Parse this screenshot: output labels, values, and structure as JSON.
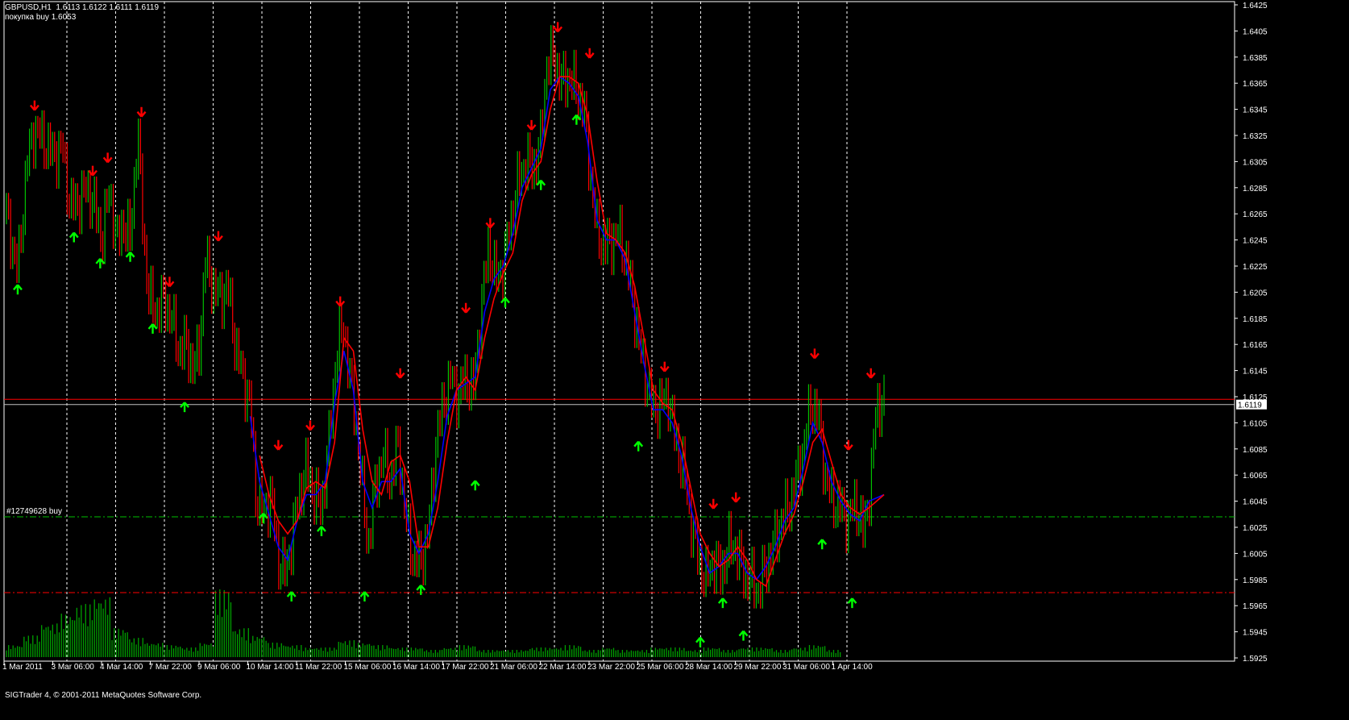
{
  "header": {
    "symbol_line": "GBPUSD,H1  1.6113 1.6122 1.6111 1.6119",
    "order_line": "покупка buy 1.6053"
  },
  "order_label": "#12749628 buy",
  "copyright": "SIGTrader 4, © 2001-2011 MetaQuotes Software Corp.",
  "colors": {
    "background": "#000000",
    "up_bar": "#00c000",
    "down_bar": "#ff0000",
    "ma_fast": "#0000ff",
    "ma_slow": "#ff0000",
    "buy_arrow": "#00ff00",
    "sell_arrow": "#ff0000",
    "volume": "#00a000",
    "grid": "#ffffff",
    "order_line": "#00c000",
    "stop_line": "#ff0000"
  },
  "chart_data": {
    "type": "candlestick",
    "symbol": "GBPUSD",
    "timeframe": "H1",
    "last": {
      "open": 1.6113,
      "high": 1.6122,
      "low": 1.6111,
      "close": 1.6119
    },
    "ylim": [
      1.5925,
      1.6425
    ],
    "yticks": [
      "1.6425",
      "1.6405",
      "1.6385",
      "1.6365",
      "1.6345",
      "1.6325",
      "1.6305",
      "1.6285",
      "1.6265",
      "1.6245",
      "1.6225",
      "1.6205",
      "1.6185",
      "1.6165",
      "1.6145",
      "1.6125",
      "1.6105",
      "1.6085",
      "1.6065",
      "1.6045",
      "1.6025",
      "1.6005",
      "1.5985",
      "1.5965",
      "1.5945",
      "1.5925"
    ],
    "current_price_label": "1.6119",
    "xticks": [
      "1 Mar 2011",
      "3 Mar 06:00",
      "4 Mar 14:00",
      "7 Mar 22:00",
      "9 Mar 06:00",
      "10 Mar 14:00",
      "11 Mar 22:00",
      "15 Mar 06:00",
      "16 Mar 14:00",
      "17 Mar 22:00",
      "21 Mar 06:00",
      "22 Mar 14:00",
      "23 Mar 22:00",
      "25 Mar 06:00",
      "28 Mar 14:00",
      "29 Mar 22:00",
      "31 Mar 06:00",
      "1 Apr 14:00"
    ],
    "grid": true,
    "price_path": [
      [
        0,
        1.6265
      ],
      [
        0.6,
        1.622
      ],
      [
        1.1,
        1.6305
      ],
      [
        1.5,
        1.633
      ],
      [
        2,
        1.632
      ],
      [
        2.5,
        1.631
      ],
      [
        3,
        1.6315
      ],
      [
        3.4,
        1.627
      ],
      [
        3.9,
        1.6275
      ],
      [
        4.3,
        1.6285
      ],
      [
        4.7,
        1.627
      ],
      [
        5.1,
        1.6245
      ],
      [
        5.5,
        1.6285
      ],
      [
        5.9,
        1.624
      ],
      [
        6.2,
        1.626
      ],
      [
        6.6,
        1.6245
      ],
      [
        7,
        1.633
      ],
      [
        7.3,
        1.625
      ],
      [
        7.6,
        1.62
      ],
      [
        8,
        1.619
      ],
      [
        8.4,
        1.62
      ],
      [
        8.8,
        1.6185
      ],
      [
        9.2,
        1.616
      ],
      [
        9.6,
        1.6165
      ],
      [
        10,
        1.6145
      ],
      [
        10.3,
        1.6165
      ],
      [
        10.6,
        1.623
      ],
      [
        11,
        1.621
      ],
      [
        11.4,
        1.62
      ],
      [
        11.8,
        1.621
      ],
      [
        12.2,
        1.6165
      ],
      [
        12.6,
        1.614
      ],
      [
        13,
        1.612
      ],
      [
        13.3,
        1.605
      ],
      [
        13.7,
        1.6035
      ],
      [
        14.1,
        1.605
      ],
      [
        14.5,
        1.6
      ],
      [
        14.9,
        1.599
      ],
      [
        15.2,
        1.6015
      ],
      [
        15.6,
        1.605
      ],
      [
        16,
        1.607
      ],
      [
        16.4,
        1.605
      ],
      [
        16.8,
        1.604
      ],
      [
        17.2,
        1.609
      ],
      [
        17.6,
        1.616
      ],
      [
        18,
        1.618
      ],
      [
        18.3,
        1.614
      ],
      [
        18.7,
        1.61
      ],
      [
        19,
        1.605
      ],
      [
        19.3,
        1.601
      ],
      [
        19.7,
        1.606
      ],
      [
        20.1,
        1.608
      ],
      [
        20.5,
        1.606
      ],
      [
        20.9,
        1.609
      ],
      [
        21.3,
        1.603
      ],
      [
        21.7,
        1.6
      ],
      [
        22.1,
        1.6
      ],
      [
        22.5,
        1.602
      ],
      [
        22.9,
        1.609
      ],
      [
        23.3,
        1.612
      ],
      [
        23.7,
        1.614
      ],
      [
        24.1,
        1.6125
      ],
      [
        24.5,
        1.614
      ],
      [
        24.9,
        1.613
      ],
      [
        25.3,
        1.619
      ],
      [
        25.7,
        1.624
      ],
      [
        26.1,
        1.6215
      ],
      [
        26.5,
        1.6225
      ],
      [
        26.9,
        1.626
      ],
      [
        27.3,
        1.629
      ],
      [
        27.7,
        1.6305
      ],
      [
        28.1,
        1.63
      ],
      [
        28.5,
        1.632
      ],
      [
        28.8,
        1.638
      ],
      [
        29.2,
        1.6385
      ],
      [
        29.6,
        1.6365
      ],
      [
        30,
        1.637
      ],
      [
        30.4,
        1.636
      ],
      [
        30.8,
        1.6345
      ],
      [
        31.1,
        1.63
      ],
      [
        31.5,
        1.625
      ],
      [
        31.9,
        1.624
      ],
      [
        32.3,
        1.6245
      ],
      [
        32.7,
        1.625
      ],
      [
        33.1,
        1.6225
      ],
      [
        33.4,
        1.62
      ],
      [
        33.8,
        1.616
      ],
      [
        34.1,
        1.614
      ],
      [
        34.5,
        1.6115
      ],
      [
        34.9,
        1.612
      ],
      [
        35.3,
        1.6125
      ],
      [
        35.7,
        1.609
      ],
      [
        36.1,
        1.607
      ],
      [
        36.5,
        1.603
      ],
      [
        36.9,
        1.6
      ],
      [
        37.3,
        1.5985
      ],
      [
        37.7,
        1.6
      ],
      [
        38.1,
        1.599
      ],
      [
        38.5,
        1.601
      ],
      [
        38.9,
        1.601
      ],
      [
        39.3,
        1.599
      ],
      [
        39.7,
        1.5985
      ],
      [
        40.1,
        1.5975
      ],
      [
        40.5,
        1.5995
      ],
      [
        40.9,
        1.601
      ],
      [
        41.3,
        1.603
      ],
      [
        41.7,
        1.604
      ],
      [
        42.1,
        1.606
      ],
      [
        42.5,
        1.6085
      ],
      [
        42.9,
        1.612
      ],
      [
        43.3,
        1.611
      ],
      [
        43.7,
        1.606
      ],
      [
        44.1,
        1.6045
      ],
      [
        44.5,
        1.604
      ],
      [
        44.9,
        1.603
      ],
      [
        45.3,
        1.6045
      ],
      [
        45.7,
        1.602
      ],
      [
        46.1,
        1.606
      ],
      [
        46.4,
        1.612
      ],
      [
        46.8,
        1.6119
      ]
    ],
    "ma_fast_path": [
      [
        13,
        1.611
      ],
      [
        13.5,
        1.606
      ],
      [
        14,
        1.6035
      ],
      [
        14.5,
        1.601
      ],
      [
        15,
        1.6
      ],
      [
        15.5,
        1.603
      ],
      [
        16,
        1.605
      ],
      [
        16.5,
        1.605
      ],
      [
        17,
        1.606
      ],
      [
        17.5,
        1.612
      ],
      [
        18,
        1.616
      ],
      [
        18.5,
        1.613
      ],
      [
        19,
        1.606
      ],
      [
        19.5,
        1.604
      ],
      [
        20,
        1.606
      ],
      [
        20.5,
        1.606
      ],
      [
        21,
        1.607
      ],
      [
        21.5,
        1.602
      ],
      [
        22,
        1.6005
      ],
      [
        22.5,
        1.602
      ],
      [
        23,
        1.606
      ],
      [
        23.5,
        1.611
      ],
      [
        24,
        1.613
      ],
      [
        24.5,
        1.6135
      ],
      [
        25,
        1.614
      ],
      [
        25.5,
        1.619
      ],
      [
        26,
        1.6215
      ],
      [
        26.5,
        1.6225
      ],
      [
        27,
        1.625
      ],
      [
        27.5,
        1.6285
      ],
      [
        28,
        1.63
      ],
      [
        28.5,
        1.6315
      ],
      [
        29,
        1.636
      ],
      [
        29.5,
        1.637
      ],
      [
        30,
        1.6365
      ],
      [
        30.5,
        1.6355
      ],
      [
        31,
        1.632
      ],
      [
        31.5,
        1.626
      ],
      [
        32,
        1.6245
      ],
      [
        32.5,
        1.6245
      ],
      [
        33,
        1.623
      ],
      [
        33.5,
        1.619
      ],
      [
        34,
        1.615
      ],
      [
        34.5,
        1.6115
      ],
      [
        35,
        1.6115
      ],
      [
        35.5,
        1.6105
      ],
      [
        36,
        1.608
      ],
      [
        36.5,
        1.604
      ],
      [
        37,
        1.601
      ],
      [
        37.5,
        1.599
      ],
      [
        38,
        1.5995
      ],
      [
        38.5,
        1.6005
      ],
      [
        39,
        1.6005
      ],
      [
        39.5,
        1.599
      ],
      [
        40,
        1.5985
      ],
      [
        40.5,
        1.5995
      ],
      [
        41,
        1.601
      ],
      [
        41.5,
        1.603
      ],
      [
        42,
        1.604
      ],
      [
        42.5,
        1.607
      ],
      [
        43,
        1.6105
      ],
      [
        43.5,
        1.609
      ],
      [
        44,
        1.606
      ],
      [
        44.5,
        1.6045
      ],
      [
        45,
        1.6035
      ],
      [
        45.5,
        1.603
      ],
      [
        46,
        1.6045
      ],
      [
        46.8,
        1.605
      ]
    ],
    "ma_slow_path": [
      [
        13.5,
        1.608
      ],
      [
        14,
        1.605
      ],
      [
        14.5,
        1.603
      ],
      [
        15,
        1.602
      ],
      [
        15.5,
        1.603
      ],
      [
        16,
        1.6055
      ],
      [
        16.5,
        1.606
      ],
      [
        17,
        1.6055
      ],
      [
        17.5,
        1.609
      ],
      [
        18,
        1.617
      ],
      [
        18.5,
        1.616
      ],
      [
        19,
        1.61
      ],
      [
        19.5,
        1.606
      ],
      [
        20,
        1.605
      ],
      [
        20.5,
        1.6075
      ],
      [
        21,
        1.608
      ],
      [
        21.5,
        1.606
      ],
      [
        22,
        1.601
      ],
      [
        22.5,
        1.601
      ],
      [
        23,
        1.604
      ],
      [
        23.5,
        1.609
      ],
      [
        24,
        1.613
      ],
      [
        24.5,
        1.614
      ],
      [
        25,
        1.613
      ],
      [
        25.5,
        1.617
      ],
      [
        26,
        1.62
      ],
      [
        26.5,
        1.622
      ],
      [
        27,
        1.6235
      ],
      [
        27.5,
        1.6275
      ],
      [
        28,
        1.6295
      ],
      [
        28.5,
        1.6305
      ],
      [
        29,
        1.6345
      ],
      [
        29.5,
        1.637
      ],
      [
        30,
        1.637
      ],
      [
        30.5,
        1.6365
      ],
      [
        31,
        1.634
      ],
      [
        31.5,
        1.629
      ],
      [
        32,
        1.625
      ],
      [
        32.5,
        1.6245
      ],
      [
        33,
        1.6235
      ],
      [
        33.5,
        1.621
      ],
      [
        34,
        1.617
      ],
      [
        34.5,
        1.613
      ],
      [
        35,
        1.612
      ],
      [
        35.5,
        1.6115
      ],
      [
        36,
        1.609
      ],
      [
        36.5,
        1.6055
      ],
      [
        37,
        1.602
      ],
      [
        37.5,
        1.6005
      ],
      [
        38,
        1.5995
      ],
      [
        38.5,
        1.6
      ],
      [
        39,
        1.601
      ],
      [
        39.5,
        1.6
      ],
      [
        40,
        1.5985
      ],
      [
        40.5,
        1.598
      ],
      [
        41,
        1.6
      ],
      [
        41.5,
        1.602
      ],
      [
        42,
        1.6035
      ],
      [
        42.5,
        1.606
      ],
      [
        43,
        1.609
      ],
      [
        43.5,
        1.61
      ],
      [
        44,
        1.6075
      ],
      [
        44.5,
        1.605
      ],
      [
        45,
        1.604
      ],
      [
        45.5,
        1.6035
      ],
      [
        46,
        1.604
      ],
      [
        46.8,
        1.605
      ]
    ],
    "sell_arrows": [
      [
        1.5,
        1.6345
      ],
      [
        4.6,
        1.6295
      ],
      [
        5.4,
        1.6305
      ],
      [
        7.2,
        1.634
      ],
      [
        8.7,
        1.621
      ],
      [
        11.3,
        1.6245
      ],
      [
        14.5,
        1.6085
      ],
      [
        16.2,
        1.61
      ],
      [
        17.8,
        1.6195
      ],
      [
        21,
        1.614
      ],
      [
        24.5,
        1.619
      ],
      [
        25.8,
        1.6255
      ],
      [
        28,
        1.633
      ],
      [
        29.4,
        1.6405
      ],
      [
        31.1,
        1.6385
      ],
      [
        35.1,
        1.6145
      ],
      [
        37.7,
        1.604
      ],
      [
        38.9,
        1.6045
      ],
      [
        43.1,
        1.6155
      ],
      [
        44.9,
        1.6085
      ],
      [
        46.1,
        1.614
      ]
    ],
    "buy_arrows": [
      [
        0.6,
        1.621
      ],
      [
        3.6,
        1.625
      ],
      [
        5,
        1.623
      ],
      [
        6.6,
        1.6235
      ],
      [
        7.8,
        1.618
      ],
      [
        9.5,
        1.612
      ],
      [
        13.7,
        1.6035
      ],
      [
        15.2,
        1.5975
      ],
      [
        16.8,
        1.6025
      ],
      [
        19.1,
        1.5975
      ],
      [
        22.1,
        1.598
      ],
      [
        25,
        1.606
      ],
      [
        26.6,
        1.62
      ],
      [
        28.5,
        1.629
      ],
      [
        30.4,
        1.634
      ],
      [
        33.7,
        1.609
      ],
      [
        37,
        1.594
      ],
      [
        38.2,
        1.597
      ],
      [
        39.3,
        1.5945
      ],
      [
        43.5,
        1.6015
      ],
      [
        45.1,
        1.597
      ]
    ],
    "volume": [
      5,
      9,
      14,
      18,
      22,
      25,
      12,
      8,
      6,
      5,
      4,
      6,
      28,
      12,
      9,
      6,
      5,
      4,
      4,
      7,
      6,
      5,
      4,
      4,
      3,
      4,
      5,
      3,
      3,
      3,
      4,
      4,
      5,
      3,
      4,
      3,
      3,
      4,
      4,
      3,
      4,
      3,
      4,
      4,
      3,
      4,
      5,
      3
    ],
    "horizontal_lines": [
      {
        "price": 1.6123,
        "color": "#ff0000",
        "style": "solid"
      },
      {
        "price": 1.6119,
        "color": "#c0c0c0",
        "style": "solid"
      },
      {
        "price": 1.6033,
        "color": "#00c000",
        "style": "dashdot",
        "label": "#12749628 buy"
      },
      {
        "price": 1.5975,
        "color": "#ff0000",
        "style": "dashdot"
      }
    ]
  }
}
